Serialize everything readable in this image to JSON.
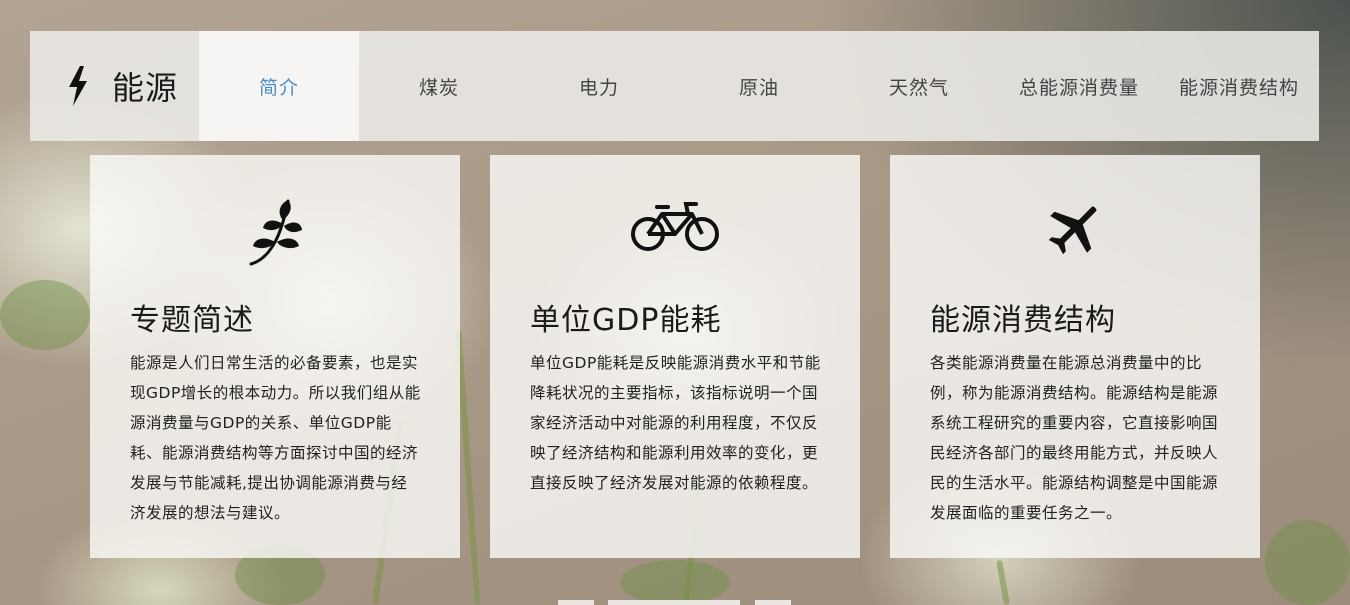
{
  "brand": {
    "label": "能源",
    "icon": "lightning-bolt-icon"
  },
  "nav": {
    "items": [
      {
        "label": "简介",
        "active": true
      },
      {
        "label": "煤炭"
      },
      {
        "label": "电力"
      },
      {
        "label": "原油"
      },
      {
        "label": "天然气"
      },
      {
        "label": "总能源消费量"
      },
      {
        "label": "能源消费结构"
      }
    ],
    "active_color": "#4a8fc4"
  },
  "cards": [
    {
      "icon": "leaf-icon",
      "title": "专题简述",
      "body": "能源是人们日常生活的必备要素，也是实现GDP增长的根本动力。所以我们组从能源消费量与GDP的关系、单位GDP能耗、能源消费结构等方面探讨中国的经济发展与节能减耗,提出协调能源消费与经济发展的想法与建议。"
    },
    {
      "icon": "bicycle-icon",
      "title": "单位GDP能耗",
      "body": "单位GDP能耗是反映能源消费水平和节能降耗状况的主要指标，该指标说明一个国家经济活动中对能源的利用程度，不仅反映了经济结构和能源利用效率的变化，更直接反映了经济发展对能源的依赖程度。"
    },
    {
      "icon": "airplane-icon",
      "title": "能源消费结构",
      "body": "各类能源消费量在能源总消费量中的比例，称为能源消费结构。能源结构是能源系统工程研究的重要内容，它直接影响国民经济各部门的最终用能方式，并反映人民的生活水平。能源结构调整是中国能源发展面临的重要任务之一。"
    }
  ]
}
